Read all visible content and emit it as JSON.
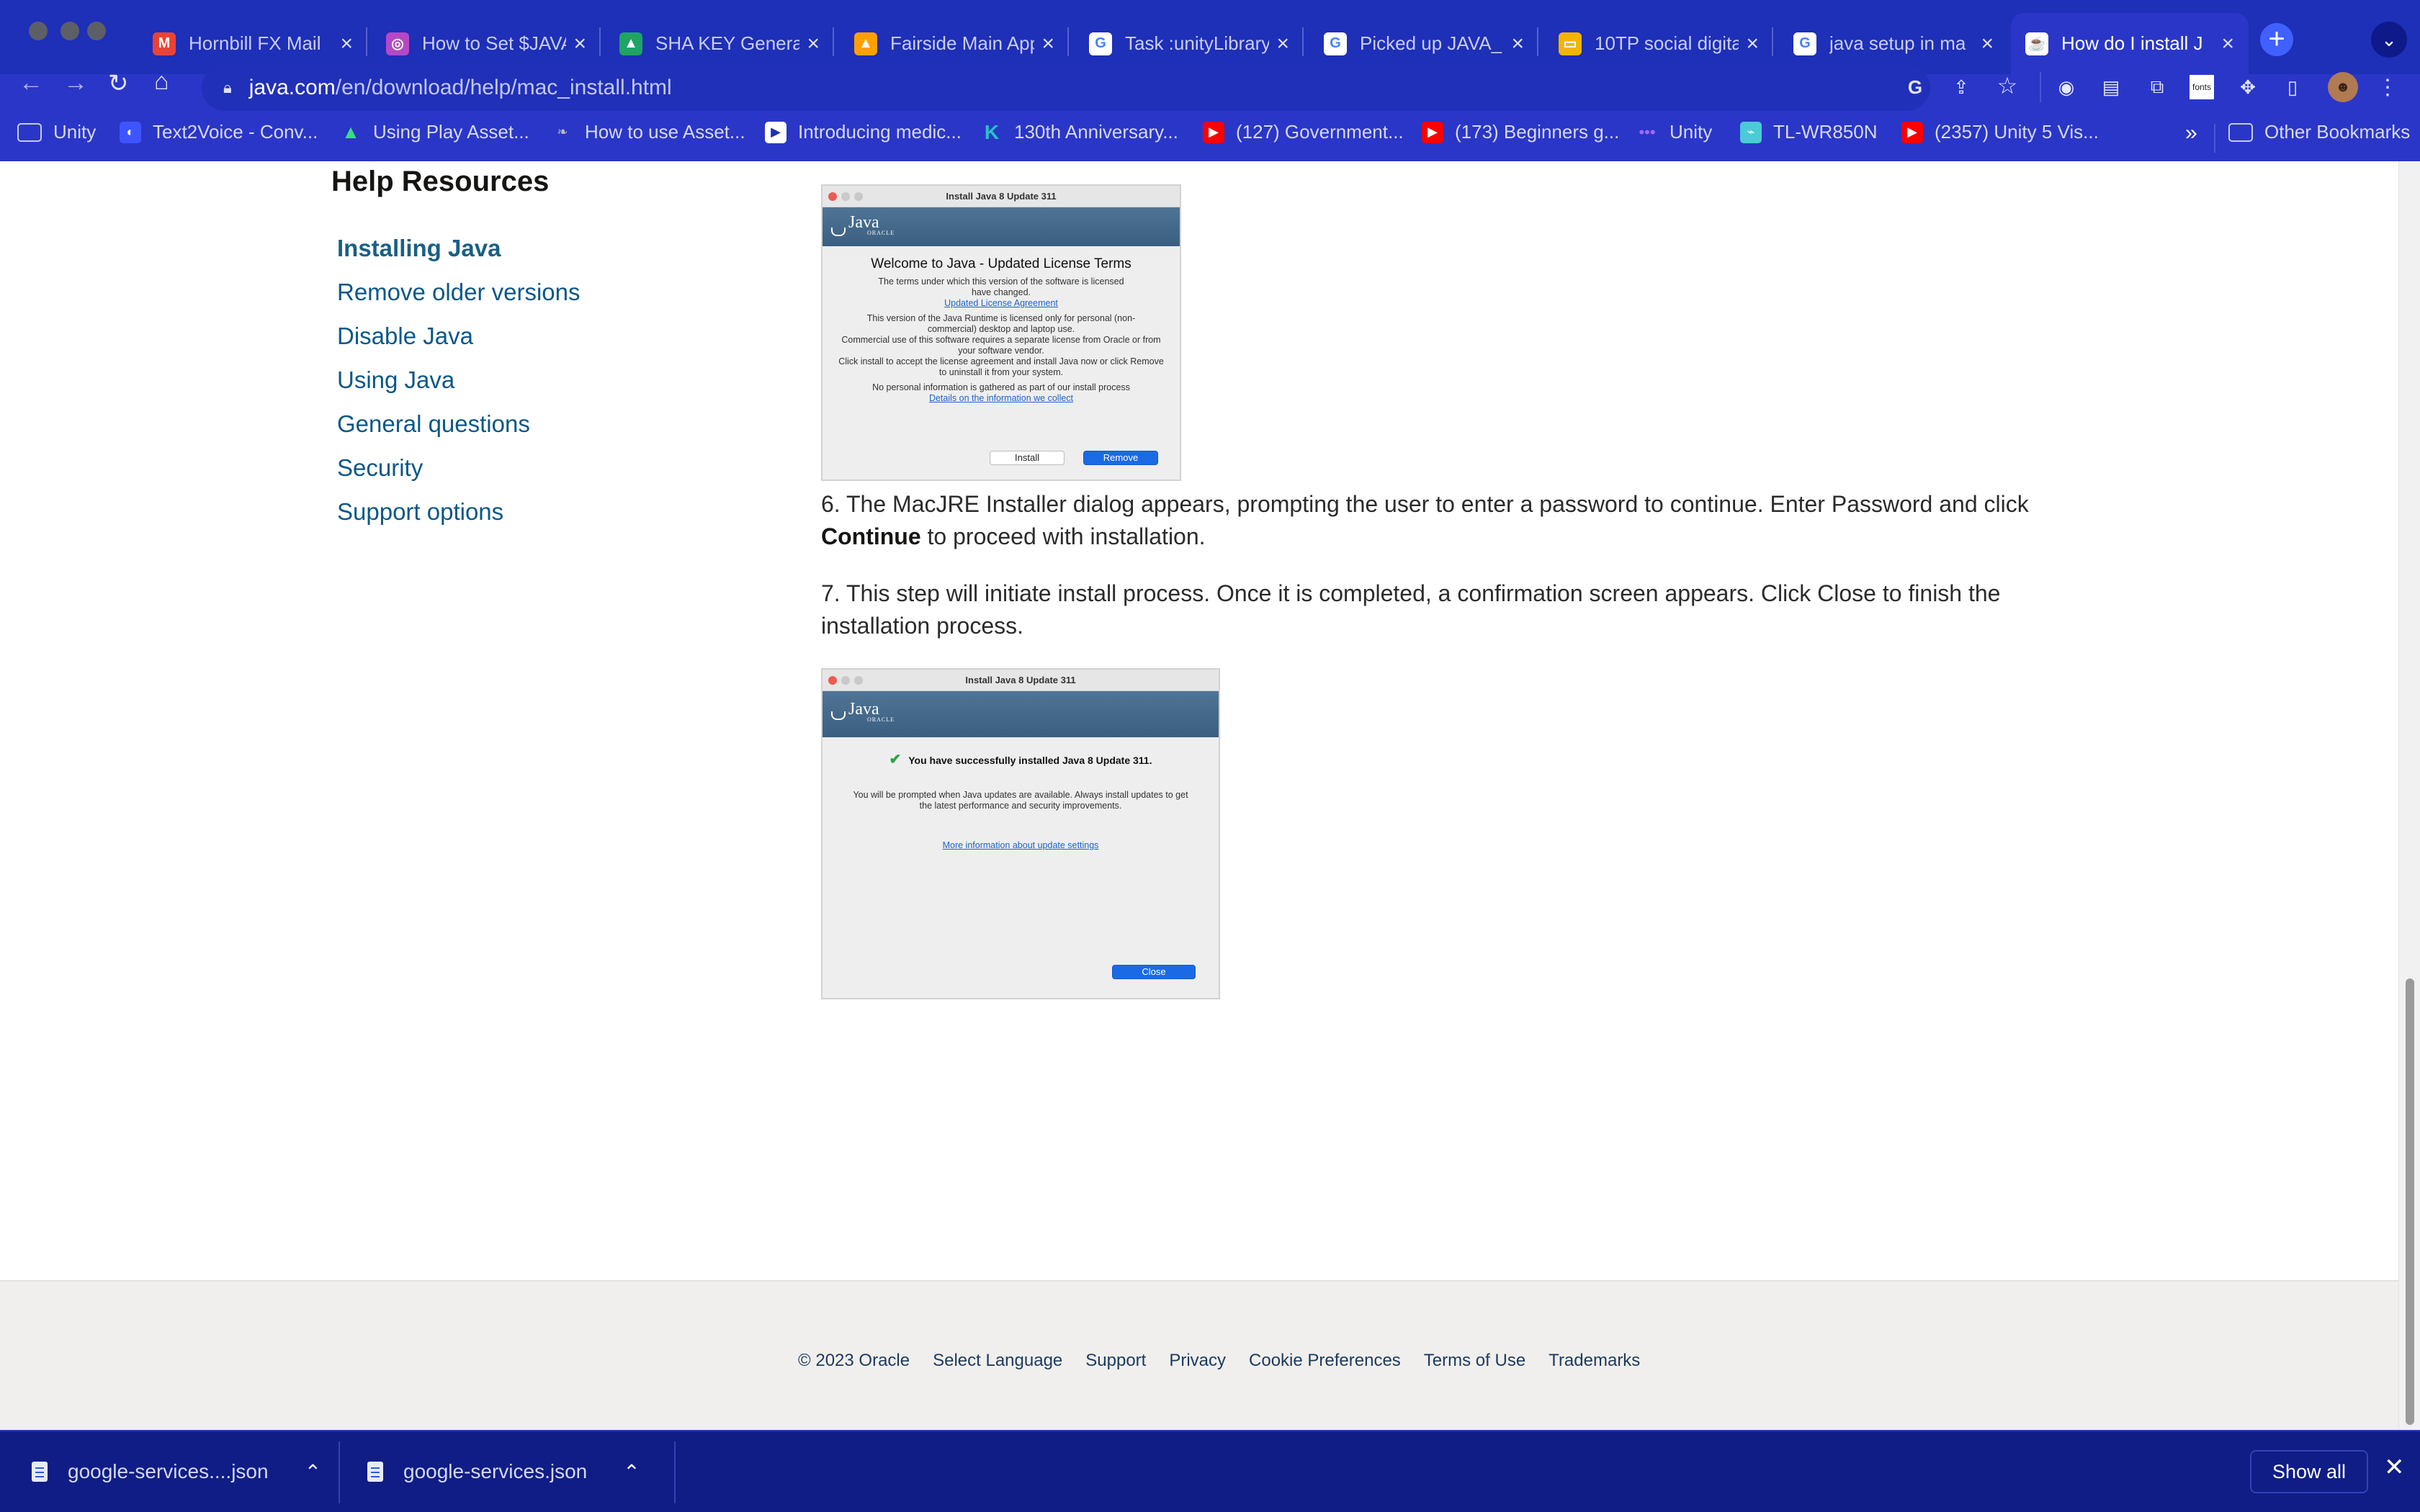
{
  "browser": {
    "tabs": [
      {
        "title": "Hornbill FX Mail",
        "icon": "gmail-icon",
        "color": "#ea4335",
        "glyph": "M"
      },
      {
        "title": "How to Set $JAVA",
        "icon": "site-icon",
        "color": "#b548c6",
        "glyph": "◎"
      },
      {
        "title": "SHA KEY Genera",
        "icon": "google-drive-icon",
        "color": "#1fa463",
        "glyph": "▲"
      },
      {
        "title": "Fairside Main App",
        "icon": "firebase-icon",
        "color": "#ffa000",
        "glyph": "▲"
      },
      {
        "title": "Task :unityLibrary",
        "icon": "google-icon",
        "color": "#ffffff",
        "glyph": "G"
      },
      {
        "title": "Picked up JAVA_",
        "icon": "google-icon",
        "color": "#ffffff",
        "glyph": "G"
      },
      {
        "title": "10TP social digita",
        "icon": "slides-icon",
        "color": "#f4b400",
        "glyph": "▭"
      },
      {
        "title": "java setup in ma",
        "icon": "google-icon",
        "color": "#ffffff",
        "glyph": "G"
      },
      {
        "title": "How do I install J",
        "icon": "java-icon",
        "color": "#e76f00",
        "glyph": "☕",
        "active": true
      }
    ],
    "url_host": "java.com",
    "url_path": "/en/download/help/mac_install.html",
    "bookmarks": [
      {
        "label": "Unity",
        "icon": "folder-icon"
      },
      {
        "label": "Text2Voice - Conv...",
        "icon": "site-icon"
      },
      {
        "label": "Using Play Asset...",
        "icon": "android-icon"
      },
      {
        "label": "How to use Asset...",
        "icon": "site-icon"
      },
      {
        "label": "Introducing medic...",
        "icon": "site-icon"
      },
      {
        "label": "130th Anniversary...",
        "icon": "k-icon"
      },
      {
        "label": "(127) Government...",
        "icon": "youtube-icon"
      },
      {
        "label": "(173) Beginners g...",
        "icon": "youtube-icon"
      },
      {
        "label": "Unity",
        "icon": "dots-icon"
      },
      {
        "label": "TL-WR850N",
        "icon": "router-icon"
      },
      {
        "label": "(2357) Unity 5 Vis...",
        "icon": "youtube-icon"
      }
    ],
    "bookmarks_overflow": "»",
    "other_bookmarks": "Other Bookmarks"
  },
  "sidebar": {
    "title": "Help Resources",
    "links": [
      {
        "label": "Installing Java",
        "active": true
      },
      {
        "label": "Remove older versions"
      },
      {
        "label": "Disable Java"
      },
      {
        "label": "Using Java"
      },
      {
        "label": "General questions"
      },
      {
        "label": "Security"
      },
      {
        "label": "Support options"
      }
    ]
  },
  "content": {
    "shot1": {
      "window_title": "Install Java 8 Update 311",
      "logo": "Java",
      "logo_sub": "ORACLE",
      "heading": "Welcome to Java - Updated License Terms",
      "p1": "The terms under which this version of the software is licensed have changed.",
      "link1": "Updated License Agreement",
      "p2": "This version of the Java Runtime is licensed only for personal (non-commercial) desktop and laptop use.",
      "p3": "Commercial use of this software requires a separate license from Oracle or from your software vendor.",
      "p4": "Click install to accept the license agreement and install Java now or click Remove to uninstall it from your system.",
      "p5": "No personal information is gathered as part of our install process",
      "link2": "Details on the information we collect",
      "btn_install": "Install",
      "btn_remove": "Remove"
    },
    "step6_prefix": "6.  The MacJRE Installer dialog appears, prompting the user to enter a password to continue. Enter Password and click ",
    "step6_bold": "Continue",
    "step6_suffix": " to proceed with installation.",
    "step7": "7.  This step will initiate install process. Once it is completed, a confirmation screen appears. Click Close to finish the installation process.",
    "shot2": {
      "window_title": "Install Java 8 Update 311",
      "logo": "Java",
      "logo_sub": "ORACLE",
      "success": "You have successfully installed Java 8 Update 311.",
      "info": "You will be prompted when Java updates are available. Always install updates to get the latest performance and security improvements.",
      "link": "More information about update settings",
      "btn_close": "Close"
    }
  },
  "footer": {
    "links": [
      "© 2023 Oracle",
      "Select Language",
      "Support",
      "Privacy",
      "Cookie Preferences",
      "Terms of Use",
      "Trademarks"
    ]
  },
  "downloads": {
    "items": [
      {
        "name": "google-services....json"
      },
      {
        "name": "google-services.json"
      }
    ],
    "show_all": "Show all"
  }
}
